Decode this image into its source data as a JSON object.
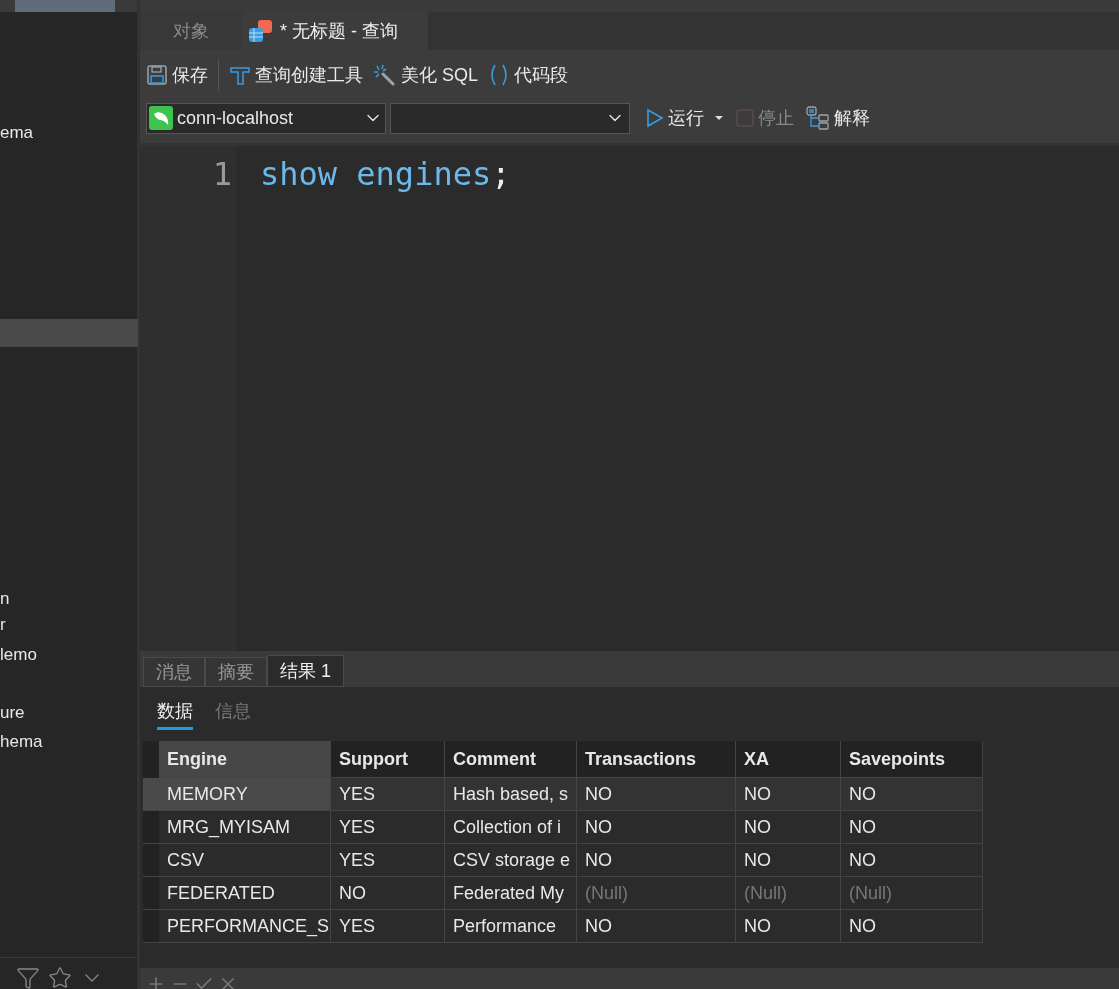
{
  "sidebar": {
    "items": [
      {
        "label": "ema",
        "selected": false
      },
      {
        "selected": true
      },
      {
        "label": "n",
        "selected": false
      },
      {
        "label": "r",
        "selected": false
      },
      {
        "label": "lemo",
        "selected": false
      },
      {
        "label": "ure",
        "selected": false
      },
      {
        "label": "hema",
        "selected": false
      }
    ]
  },
  "tabs": [
    {
      "label": "对象",
      "selected": false,
      "kind": "plain"
    },
    {
      "label": "* 无标题 - 查询",
      "selected": true,
      "kind": "query"
    }
  ],
  "toolbar": [
    {
      "label": "保存",
      "kind": "save"
    },
    {
      "label": "查询创建工具",
      "kind": "builder"
    },
    {
      "label": "美化 SQL",
      "kind": "beautify"
    },
    {
      "label": "代码段",
      "kind": "snippet"
    }
  ],
  "connection": {
    "value": "conn-localhost"
  },
  "actions": [
    {
      "label": "运行",
      "kind": "run",
      "disabled": false
    },
    {
      "label": "停止",
      "kind": "stop",
      "disabled": true
    },
    {
      "label": "解释",
      "kind": "explain",
      "disabled": false
    }
  ],
  "editor": {
    "line_number": "1",
    "tokens": [
      {
        "text": "show engines",
        "kind": "keyword"
      },
      {
        "text": ";",
        "kind": "punct"
      }
    ]
  },
  "result_tabs": [
    {
      "label": "消息",
      "selected": false
    },
    {
      "label": "摘要",
      "selected": false
    },
    {
      "label": "结果 1",
      "selected": true
    }
  ],
  "sub_tabs": [
    {
      "label": "数据",
      "selected": true
    },
    {
      "label": "信息",
      "selected": false
    }
  ],
  "table": {
    "columns": [
      "Engine",
      "Support",
      "Comment",
      "Transactions",
      "XA",
      "Savepoints"
    ],
    "rows": [
      {
        "selected": true,
        "cells": [
          {
            "text": "MEMORY",
            "null": false
          },
          {
            "text": "YES",
            "null": false
          },
          {
            "text": "Hash based, s",
            "null": false
          },
          {
            "text": "NO",
            "null": false
          },
          {
            "text": "NO",
            "null": false
          },
          {
            "text": "NO",
            "null": false
          }
        ]
      },
      {
        "selected": false,
        "cells": [
          {
            "text": "MRG_MYISAM",
            "null": false
          },
          {
            "text": "YES",
            "null": false
          },
          {
            "text": "Collection of i",
            "null": false
          },
          {
            "text": "NO",
            "null": false
          },
          {
            "text": "NO",
            "null": false
          },
          {
            "text": "NO",
            "null": false
          }
        ]
      },
      {
        "selected": false,
        "cells": [
          {
            "text": "CSV",
            "null": false
          },
          {
            "text": "YES",
            "null": false
          },
          {
            "text": "CSV storage e",
            "null": false
          },
          {
            "text": "NO",
            "null": false
          },
          {
            "text": "NO",
            "null": false
          },
          {
            "text": "NO",
            "null": false
          }
        ]
      },
      {
        "selected": false,
        "cells": [
          {
            "text": "FEDERATED",
            "null": false
          },
          {
            "text": "NO",
            "null": false
          },
          {
            "text": "Federated My",
            "null": false
          },
          {
            "text": "(Null)",
            "null": true
          },
          {
            "text": "(Null)",
            "null": true
          },
          {
            "text": "(Null)",
            "null": true
          }
        ]
      },
      {
        "selected": false,
        "cells": [
          {
            "text": "PERFORMANCE_S",
            "null": false
          },
          {
            "text": "YES",
            "null": false
          },
          {
            "text": "Performance",
            "null": false
          },
          {
            "text": "NO",
            "null": false
          },
          {
            "text": "NO",
            "null": false
          },
          {
            "text": "NO",
            "null": false
          }
        ]
      }
    ]
  }
}
